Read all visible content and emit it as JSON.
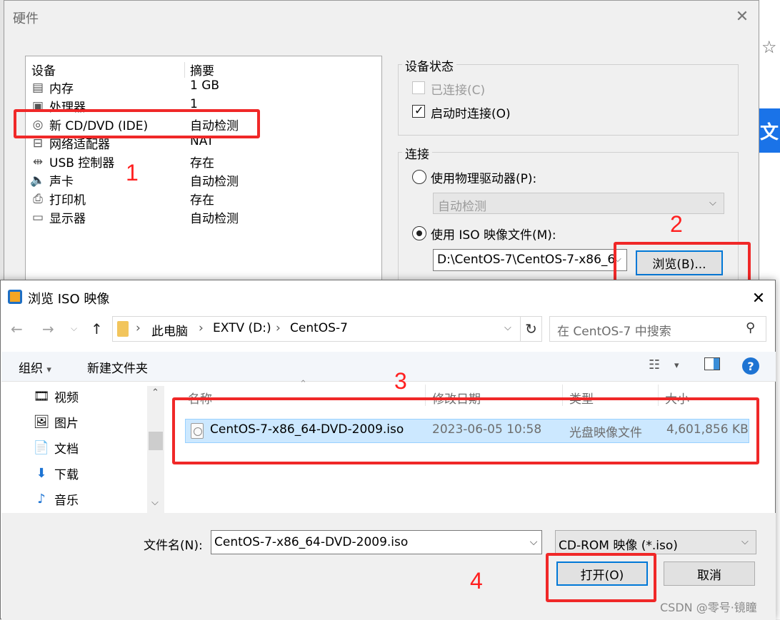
{
  "hardware_dialog": {
    "title": "硬件",
    "device_table": {
      "headers": [
        "设备",
        "摘要"
      ],
      "rows": [
        {
          "name": "内存",
          "summary": "1 GB",
          "icon": "memory-icon"
        },
        {
          "name": "处理器",
          "summary": "1",
          "icon": "cpu-icon"
        },
        {
          "name": "新 CD/DVD (IDE)",
          "summary": "自动检测",
          "icon": "cd-icon"
        },
        {
          "name": "网络适配器",
          "summary": "NAT",
          "icon": "network-icon"
        },
        {
          "name": "USB 控制器",
          "summary": "存在",
          "icon": "usb-icon"
        },
        {
          "name": "声卡",
          "summary": "自动检测",
          "icon": "speaker-icon"
        },
        {
          "name": "打印机",
          "summary": "存在",
          "icon": "printer-icon"
        },
        {
          "name": "显示器",
          "summary": "自动检测",
          "icon": "monitor-icon"
        }
      ]
    },
    "device_status": {
      "title": "设备状态",
      "connected": "已连接(C)",
      "connect_on_power_on": "启动时连接(O)"
    },
    "connection": {
      "title": "连接",
      "physical_drive": "使用物理驱动器(P):",
      "physical_drive_value": "自动检测",
      "iso_image": "使用 ISO 映像文件(M):",
      "iso_path": "D:\\CentOS-7\\CentOS-7-x86_6",
      "browse": "浏览(B)..."
    }
  },
  "browse_dialog": {
    "title": "浏览 ISO 映像",
    "breadcrumb": [
      "此电脑",
      "EXTV (D:)",
      "CentOS-7"
    ],
    "search_placeholder": "在 CentOS-7 中搜索",
    "toolbar": {
      "organize": "组织",
      "new_folder": "新建文件夹"
    },
    "nav_items": [
      {
        "label": "视频",
        "icon": "video-icon"
      },
      {
        "label": "图片",
        "icon": "pictures-icon"
      },
      {
        "label": "文档",
        "icon": "documents-icon"
      },
      {
        "label": "下载",
        "icon": "download-icon"
      },
      {
        "label": "音乐",
        "icon": "music-icon"
      }
    ],
    "columns": [
      "名称",
      "修改日期",
      "类型",
      "大小"
    ],
    "files": [
      {
        "name": "CentOS-7-x86_64-DVD-2009.iso",
        "modified": "2023-06-05 10:58",
        "type": "光盘映像文件",
        "size": "4,601,856 KB"
      }
    ],
    "filename_label": "文件名(N):",
    "filename_value": "CentOS-7-x86_64-DVD-2009.iso",
    "filter": "CD-ROM 映像 (*.iso)",
    "open": "打开(O)",
    "cancel": "取消"
  },
  "annotations": [
    "1",
    "2",
    "3",
    "4"
  ],
  "watermark": "CSDN @零号·镜瞳",
  "background": {
    "tab_glyph": "文"
  }
}
